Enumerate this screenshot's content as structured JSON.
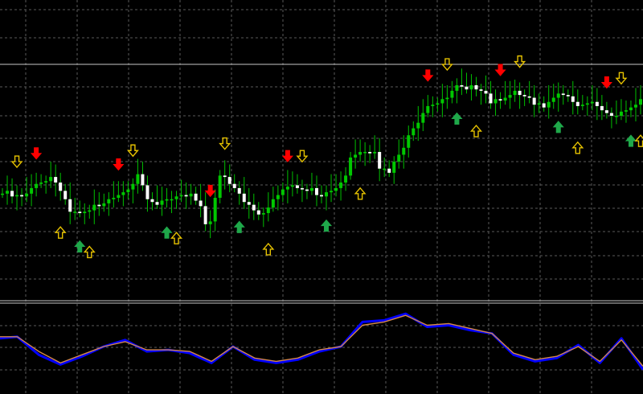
{
  "colors": {
    "background": "#000000",
    "grid": "#5a5a5a",
    "separator": "#c8c8c8",
    "candle_wick": "#00c000",
    "bull_body": "#00c800",
    "bear_body": "#ffffff",
    "sell_arrow": "#ff0000",
    "sell_outline_arrow": "#e6c200",
    "buy_arrow": "#1fa84a",
    "buy_outline_arrow": "#e6c200",
    "osc_main": "#0000ff",
    "osc_signal": "#d4884a"
  },
  "icons": {
    "sell_signal": "red-down-arrow-icon",
    "sell_confirm": "outlined-yellow-down-arrow-icon",
    "buy_signal": "green-up-arrow-icon",
    "buy_confirm": "outlined-yellow-up-arrow-icon"
  },
  "chart_data": [
    {
      "type": "candlestick",
      "title": "",
      "grid": true,
      "x": [
        1,
        2,
        3,
        4,
        5,
        6,
        7,
        8,
        9,
        10,
        11,
        12,
        13,
        14,
        15,
        16,
        17,
        18,
        19,
        20,
        21,
        22,
        23,
        24,
        25,
        26,
        27,
        28,
        29,
        30,
        31,
        32,
        33,
        34,
        35,
        36,
        37,
        38,
        39,
        40,
        41,
        42,
        43,
        44,
        45,
        46,
        47,
        48,
        49,
        50,
        51,
        52,
        53,
        54,
        55,
        56,
        57,
        58,
        59,
        60,
        61,
        62,
        63,
        64,
        65,
        66,
        67,
        68,
        69,
        70,
        71,
        72,
        73,
        74,
        75,
        76,
        77,
        78,
        79,
        80,
        81,
        82,
        83,
        84,
        85,
        86,
        87,
        88,
        89,
        90,
        91,
        92,
        93,
        94,
        95,
        96,
        97,
        98,
        99,
        100,
        101,
        102,
        103,
        104,
        105,
        106,
        107,
        108,
        109,
        110,
        111,
        112,
        113,
        114,
        115,
        116,
        117,
        118,
        119,
        120,
        121,
        122,
        123,
        124,
        125,
        126,
        127,
        128,
        129,
        130,
        131,
        132,
        133
      ],
      "close": [
        62,
        64,
        60,
        61,
        60,
        62,
        66,
        69,
        70,
        71,
        74,
        70,
        64,
        58,
        49,
        49,
        48,
        49,
        50,
        54,
        53,
        55,
        58,
        59,
        61,
        63,
        65,
        69,
        76,
        68,
        58,
        56,
        54,
        57,
        58,
        58,
        60,
        61,
        60,
        62,
        57,
        53,
        40,
        42,
        59,
        75,
        74,
        69,
        66,
        62,
        56,
        54,
        50,
        47,
        48,
        52,
        58,
        61,
        65,
        67,
        68,
        66,
        65,
        64,
        66,
        61,
        60,
        63,
        64,
        66,
        70,
        75,
        88,
        90,
        92,
        92,
        91,
        92,
        80,
        80,
        77,
        85,
        90,
        95,
        104,
        109,
        113,
        120,
        125,
        126,
        127,
        130,
        131,
        136,
        140,
        139,
        137,
        140,
        137,
        136,
        134,
        127,
        130,
        129,
        131,
        133,
        136,
        133,
        132,
        131,
        126,
        127,
        124,
        128,
        131,
        134,
        133,
        132,
        128,
        125,
        126,
        127,
        128,
        125,
        122,
        120,
        118,
        118,
        121,
        122,
        124,
        126,
        130
      ],
      "ylim": [
        0,
        140
      ],
      "signals": [
        {
          "x": 4,
          "kind": "sell_confirm"
        },
        {
          "x": 8,
          "kind": "sell_signal"
        },
        {
          "x": 13,
          "kind": "buy_confirm"
        },
        {
          "x": 17,
          "kind": "buy_signal"
        },
        {
          "x": 19,
          "kind": "buy_confirm"
        },
        {
          "x": 25,
          "kind": "sell_signal"
        },
        {
          "x": 28,
          "kind": "sell_confirm"
        },
        {
          "x": 35,
          "kind": "buy_signal"
        },
        {
          "x": 37,
          "kind": "buy_confirm"
        },
        {
          "x": 44,
          "kind": "sell_signal"
        },
        {
          "x": 47,
          "kind": "sell_confirm"
        },
        {
          "x": 50,
          "kind": "buy_signal"
        },
        {
          "x": 56,
          "kind": "buy_confirm"
        },
        {
          "x": 60,
          "kind": "sell_signal"
        },
        {
          "x": 63,
          "kind": "sell_confirm"
        },
        {
          "x": 68,
          "kind": "buy_signal"
        },
        {
          "x": 75,
          "kind": "buy_confirm"
        },
        {
          "x": 89,
          "kind": "sell_signal"
        },
        {
          "x": 93,
          "kind": "sell_confirm"
        },
        {
          "x": 95,
          "kind": "buy_signal"
        },
        {
          "x": 99,
          "kind": "buy_confirm"
        },
        {
          "x": 104,
          "kind": "sell_signal"
        },
        {
          "x": 108,
          "kind": "sell_confirm"
        },
        {
          "x": 116,
          "kind": "buy_signal"
        },
        {
          "x": 120,
          "kind": "buy_confirm"
        },
        {
          "x": 126,
          "kind": "sell_signal"
        },
        {
          "x": 129,
          "kind": "sell_confirm"
        },
        {
          "x": 131,
          "kind": "buy_signal"
        },
        {
          "x": 133,
          "kind": "buy_confirm"
        }
      ]
    },
    {
      "type": "line",
      "title": "",
      "grid": true,
      "x": [
        0,
        8,
        18,
        28,
        38,
        48,
        58,
        68,
        78,
        88,
        98,
        108,
        118,
        128,
        138,
        148,
        158,
        168,
        178,
        188,
        198,
        208,
        218,
        228,
        238,
        248,
        258,
        268,
        278,
        288,
        298
      ],
      "ylim": [
        0,
        100
      ],
      "series": [
        {
          "values": [
            60,
            62,
            40,
            28,
            38,
            50,
            58,
            44,
            46,
            42,
            30,
            50,
            34,
            30,
            34,
            44,
            50,
            80,
            82,
            90,
            74,
            76,
            70,
            66,
            40,
            32,
            36,
            52,
            30,
            60,
            22
          ]
        },
        {
          "values": [
            62,
            62,
            44,
            30,
            40,
            50,
            56,
            46,
            46,
            44,
            32,
            50,
            36,
            32,
            36,
            46,
            50,
            76,
            80,
            88,
            76,
            78,
            72,
            66,
            42,
            34,
            38,
            50,
            32,
            58,
            26
          ]
        }
      ]
    }
  ]
}
